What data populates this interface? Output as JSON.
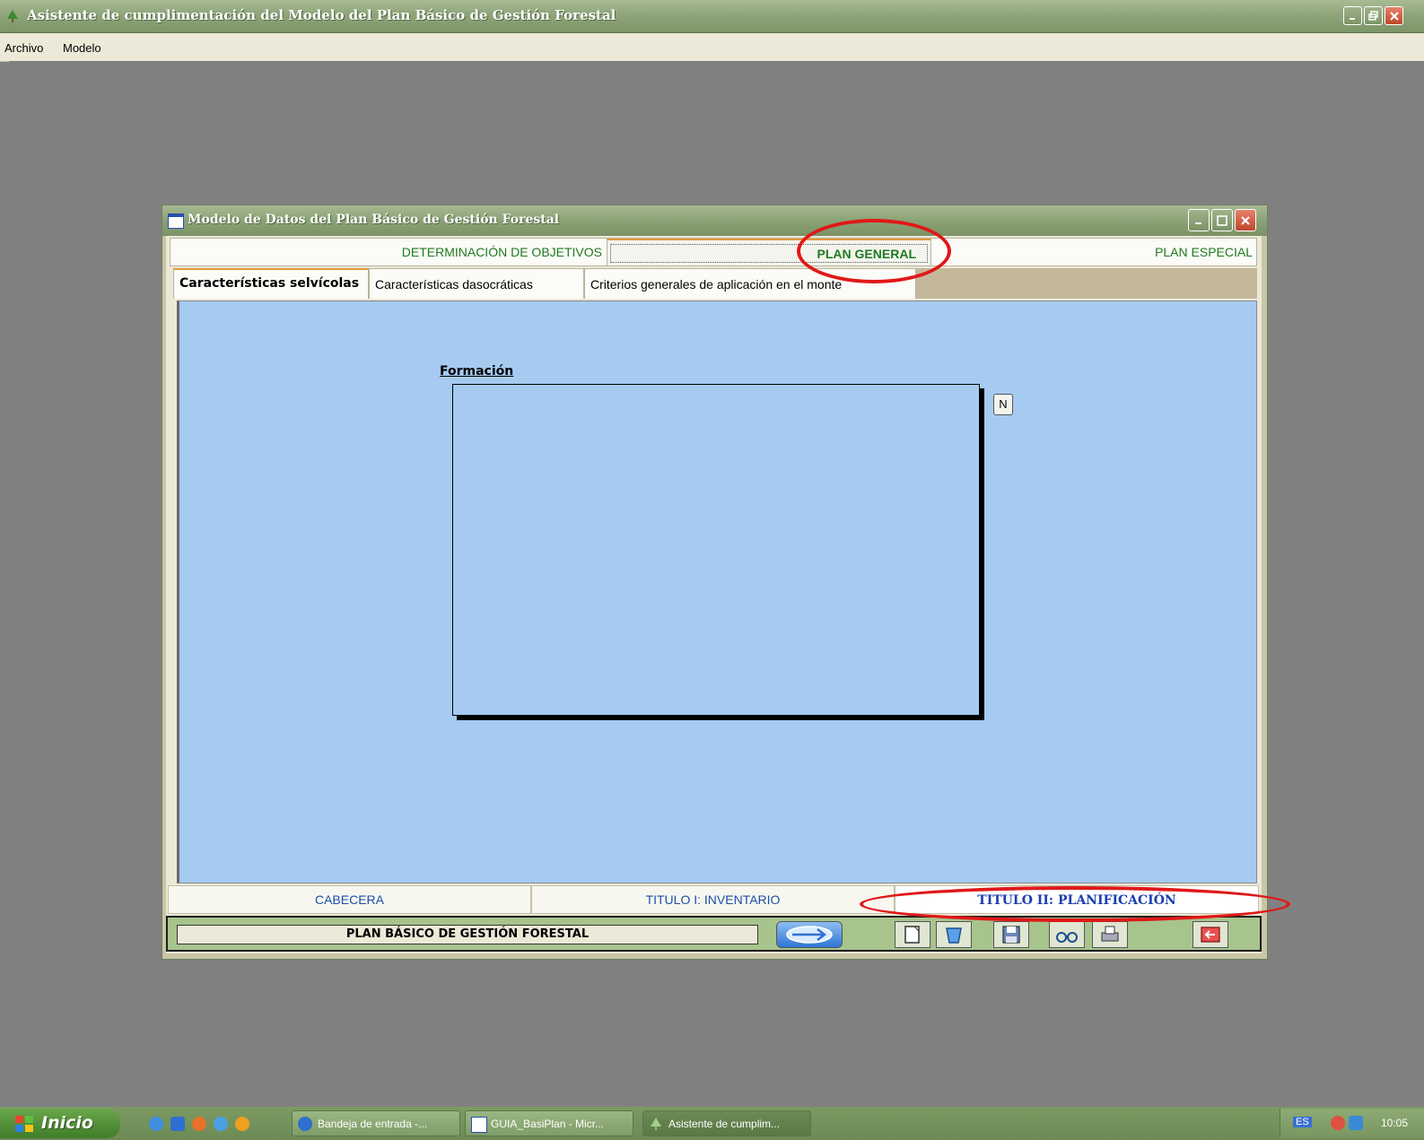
{
  "app": {
    "title": "Asistente de cumplimentación del Modelo del Plan Básico de Gestión Forestal"
  },
  "menu": {
    "items": [
      "Archivo",
      "Modelo"
    ]
  },
  "form_window": {
    "title": "Modelo de Datos del Plan Básico de Gestión Forestal"
  },
  "top_tabs": [
    {
      "label": "DETERMINACIÓN DE OBJETIVOS",
      "active": false
    },
    {
      "label": "PLAN GENERAL",
      "active": true
    },
    {
      "label": "PLAN ESPECIAL",
      "active": false
    }
  ],
  "sub_tabs": [
    {
      "label": "Características selvícolas",
      "active": true
    },
    {
      "label": "Características dasocráticas",
      "active": false
    },
    {
      "label": "Criterios generales de aplicación en el monte",
      "active": false
    }
  ],
  "panel": {
    "field_label": "Formación",
    "n_button_label": "N"
  },
  "bottom_tabs": [
    {
      "label": "CABECERA",
      "active": false
    },
    {
      "label": "TITULO I: INVENTARIO",
      "active": false
    },
    {
      "label": "TITULO II: PLANIFICACIÓN",
      "active": true
    }
  ],
  "footer": {
    "title": "PLAN BÁSICO DE GESTIÓN FORESTAL",
    "tools": [
      "next-arrow-icon",
      "new-document-icon",
      "delete-bin-icon",
      "save-icon",
      "view-glasses-icon",
      "print-icon",
      "exit-icon"
    ]
  },
  "taskbar": {
    "start_label": "Inicio",
    "tasks": [
      {
        "label": "Bandeja de entrada -...",
        "active": false
      },
      {
        "label": "GUIA_BasiPlan - Micr...",
        "active": false
      },
      {
        "label": "Asistente de cumplim...",
        "active": true
      }
    ],
    "language": "ES",
    "clock": "10:05"
  },
  "colors": {
    "annotation": "#e01818",
    "panel_bg": "#a6caf0",
    "tab_text": "#1f7a1f",
    "bottom_tab_text": "#1a4fa8"
  }
}
